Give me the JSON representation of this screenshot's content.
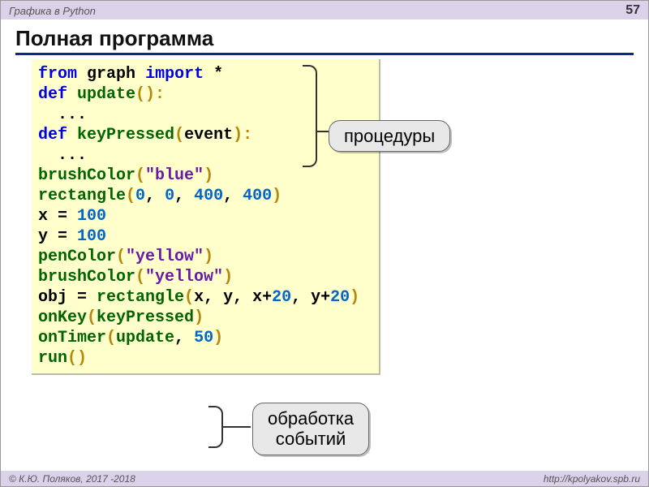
{
  "header": {
    "subject": "Графика в Python",
    "page": "57"
  },
  "title": "Полная программа",
  "callouts": {
    "procedures": "процедуры",
    "events": "обработка\nсобытий"
  },
  "code": {
    "l1": {
      "kw_from": "from",
      "mod": "graph",
      "kw_import": "import",
      "star": "*"
    },
    "l2": {
      "kw_def": "def",
      "name": "update",
      "p": "():"
    },
    "l3": "  ...",
    "l4": {
      "kw_def": "def",
      "name": "keyPressed",
      "p_open": "(",
      "arg": "event",
      "p_close": "):"
    },
    "l5": "  ...",
    "l6": {
      "fn": "brushColor",
      "po": "(",
      "str": "\"blue\"",
      "pc": ")"
    },
    "l7": {
      "fn": "rectangle",
      "po": "(",
      "n1": "0",
      "c1": ", ",
      "n2": "0",
      "c2": ", ",
      "n3": "400",
      "c3": ", ",
      "n4": "400",
      "pc": ")"
    },
    "l8": {
      "pre": "x = ",
      "n": "100"
    },
    "l9": {
      "pre": "y = ",
      "n": "100"
    },
    "l10": {
      "fn": "penColor",
      "po": "(",
      "str": "\"yellow\"",
      "pc": ")"
    },
    "l11": {
      "fn": "brushColor",
      "po": "(",
      "str": "\"yellow\"",
      "pc": ")"
    },
    "l12": {
      "pre": "obj = ",
      "fn": "rectangle",
      "po": "(",
      "a1": "x, y, x+",
      "n1": "20",
      "a2": ", y+",
      "n2": "20",
      "pc": ")"
    },
    "l13": {
      "fn": "onKey",
      "po": "(",
      "arg": "keyPressed",
      "pc": ")"
    },
    "l14": {
      "fn": "onTimer",
      "po": "(",
      "arg": "update",
      "c": ", ",
      "n": "50",
      "pc": ")"
    },
    "l15": {
      "fn": "run",
      "p": "()"
    }
  },
  "footer": {
    "left": "© К.Ю. Поляков, 2017 -2018",
    "right": "http://kpolyakov.spb.ru"
  }
}
